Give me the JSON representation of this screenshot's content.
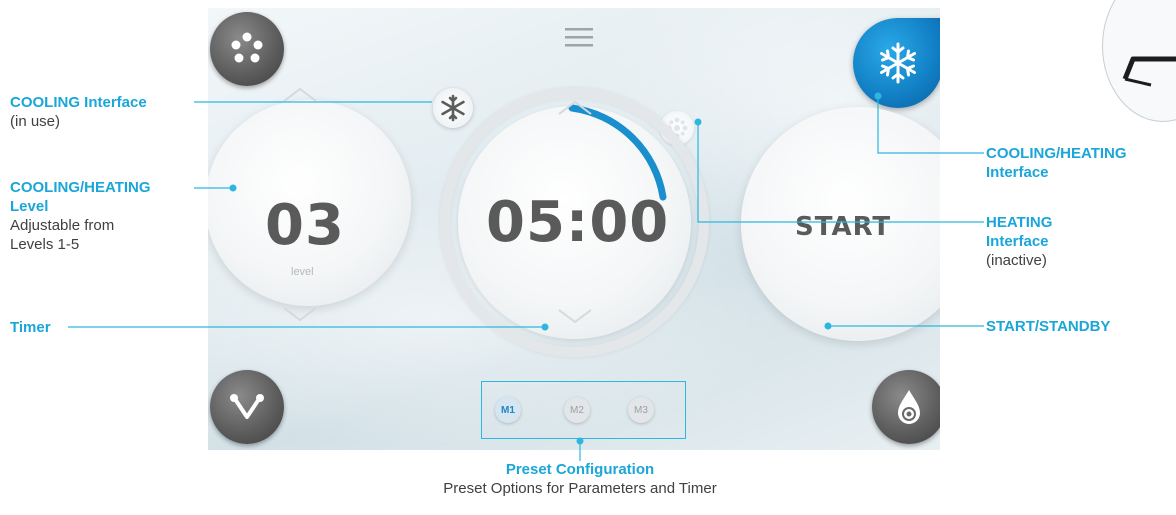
{
  "screen": {
    "level_value": "03",
    "level_caption": "level",
    "timer_value": "05:00",
    "start_label": "START",
    "presets": [
      {
        "label": "M1",
        "active": true
      },
      {
        "label": "M2",
        "active": false
      },
      {
        "label": "M3",
        "active": false
      }
    ],
    "icons": {
      "top_left": "dots-pattern-icon",
      "top_center": "menu-icon",
      "top_right": "snowflake-icon",
      "bottom_left": "bifurcation-icon",
      "bottom_right": "water-drop-icon"
    },
    "accent_color": "#1a8fce"
  },
  "annotations": {
    "cooling": {
      "title": "COOLING Interface",
      "sub": "(in use)"
    },
    "level": {
      "title_1": "COOLING/HEATING",
      "title_2": "Level",
      "sub_1": "Adjustable from",
      "sub_2": "Levels 1-5"
    },
    "timer": {
      "title": "Timer"
    },
    "mode": {
      "title_1": "COOLING/HEATING",
      "title_2": "Interface"
    },
    "heating": {
      "title_1": "HEATING",
      "title_2": "Interface",
      "sub": "(inactive)"
    },
    "start": {
      "title": "START/STANDBY"
    },
    "preset": {
      "title": "Preset Configuration",
      "sub": "Preset Options for Parameters and Timer"
    }
  }
}
